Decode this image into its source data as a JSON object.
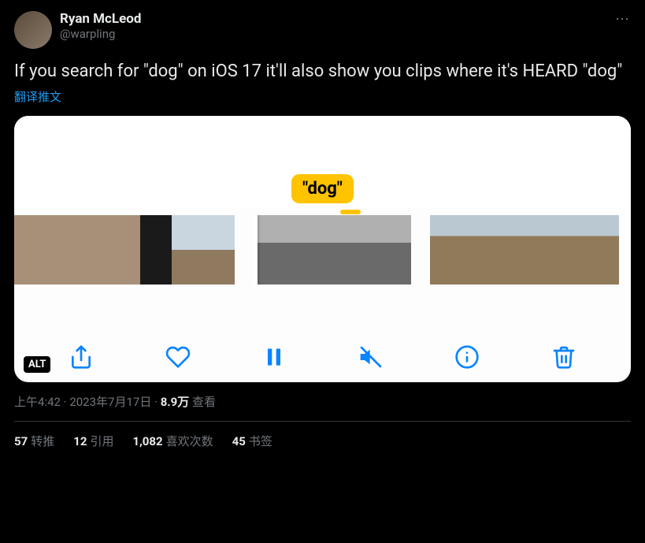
{
  "author": {
    "display_name": "Ryan McLeod",
    "handle": "@warpling"
  },
  "more_icon": "⋯",
  "tweet_text": "If you search for \"dog\" on iOS 17 it'll also show you clips where it's HEARD \"dog\"",
  "translate_label": "翻译推文",
  "media": {
    "caption_badge": "\"dog\"",
    "alt_label": "ALT"
  },
  "meta": {
    "time": "上午4:42",
    "date": "2023年7月17日",
    "views_count": "8.9万",
    "views_label": "查看",
    "separator": " · "
  },
  "stats": {
    "retweets_count": "57",
    "retweets_label": "转推",
    "quotes_count": "12",
    "quotes_label": "引用",
    "likes_count": "1,082",
    "likes_label": "喜欢次数",
    "bookmarks_count": "45",
    "bookmarks_label": "书签"
  }
}
